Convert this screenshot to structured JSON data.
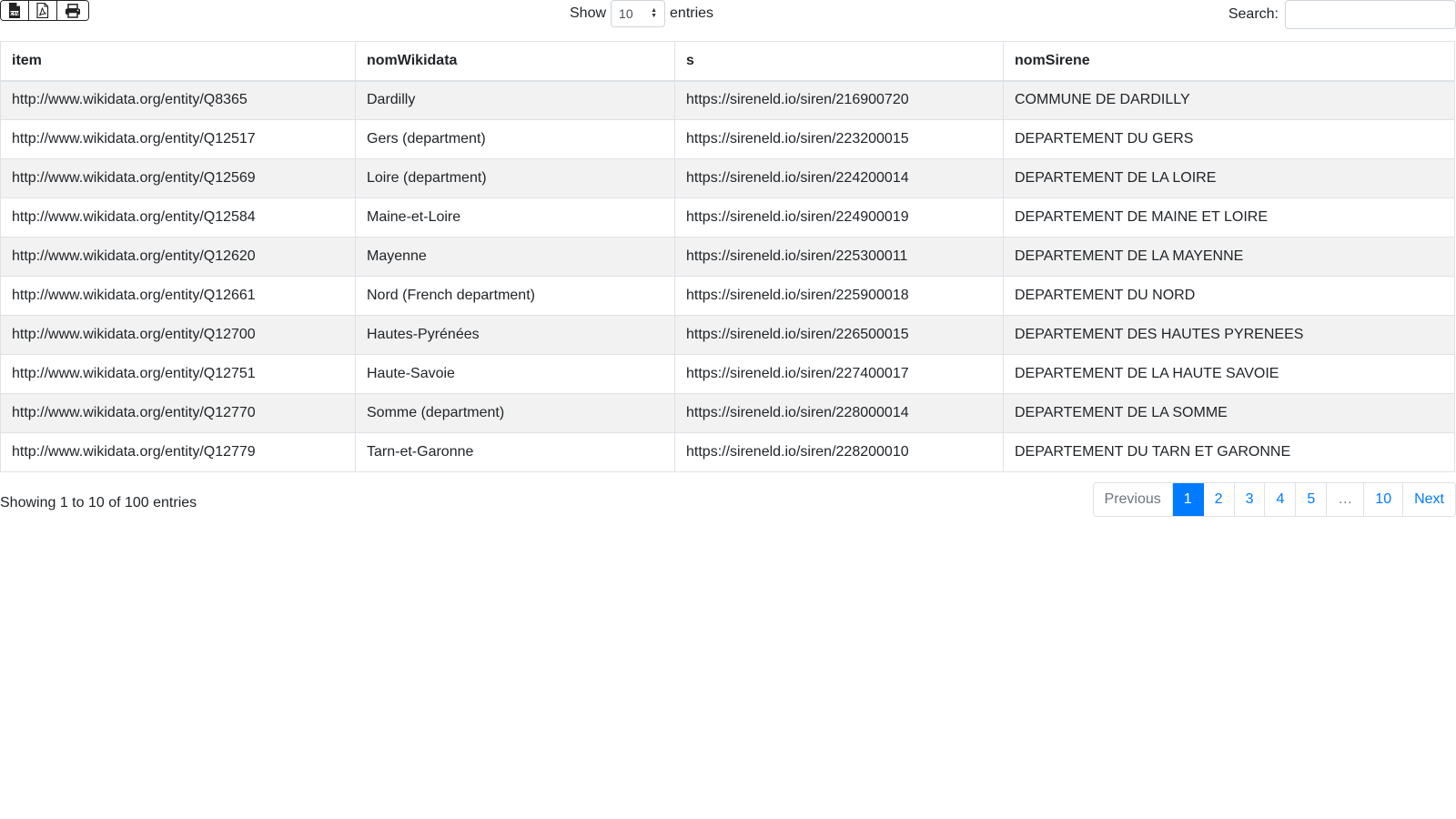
{
  "toolbar": {
    "buttons": [
      {
        "icon": "csv-file-icon"
      },
      {
        "icon": "pdf-file-icon"
      },
      {
        "icon": "print-icon"
      }
    ]
  },
  "length": {
    "show_label": "Show",
    "selected": "10",
    "entries_label": "entries"
  },
  "search": {
    "label": "Search:",
    "value": "",
    "placeholder": ""
  },
  "table": {
    "headers": [
      "item",
      "nomWikidata",
      "s",
      "nomSirene"
    ],
    "rows": [
      [
        "http://www.wikidata.org/entity/Q8365",
        "Dardilly",
        "https://sireneld.io/siren/216900720",
        "COMMUNE DE DARDILLY"
      ],
      [
        "http://www.wikidata.org/entity/Q12517",
        "Gers (department)",
        "https://sireneld.io/siren/223200015",
        "DEPARTEMENT DU GERS"
      ],
      [
        "http://www.wikidata.org/entity/Q12569",
        "Loire (department)",
        "https://sireneld.io/siren/224200014",
        "DEPARTEMENT DE LA LOIRE"
      ],
      [
        "http://www.wikidata.org/entity/Q12584",
        "Maine-et-Loire",
        "https://sireneld.io/siren/224900019",
        "DEPARTEMENT DE MAINE ET LOIRE"
      ],
      [
        "http://www.wikidata.org/entity/Q12620",
        "Mayenne",
        "https://sireneld.io/siren/225300011",
        "DEPARTEMENT DE LA MAYENNE"
      ],
      [
        "http://www.wikidata.org/entity/Q12661",
        "Nord (French department)",
        "https://sireneld.io/siren/225900018",
        "DEPARTEMENT DU NORD"
      ],
      [
        "http://www.wikidata.org/entity/Q12700",
        "Hautes-Pyrénées",
        "https://sireneld.io/siren/226500015",
        "DEPARTEMENT DES HAUTES PYRENEES"
      ],
      [
        "http://www.wikidata.org/entity/Q12751",
        "Haute-Savoie",
        "https://sireneld.io/siren/227400017",
        "DEPARTEMENT DE LA HAUTE SAVOIE"
      ],
      [
        "http://www.wikidata.org/entity/Q12770",
        "Somme (department)",
        "https://sireneld.io/siren/228000014",
        "DEPARTEMENT DE LA SOMME"
      ],
      [
        "http://www.wikidata.org/entity/Q12779",
        "Tarn-et-Garonne",
        "https://sireneld.io/siren/228200010",
        "DEPARTEMENT DU TARN ET GARONNE"
      ]
    ]
  },
  "footer": {
    "info": "Showing 1 to 10 of 100 entries"
  },
  "pagination": {
    "previous": "Previous",
    "pages": [
      "1",
      "2",
      "3",
      "4",
      "5",
      "…",
      "10"
    ],
    "active": "1",
    "next": "Next"
  },
  "colors": {
    "accent": "#007bff",
    "stripe": "#f2f2f2",
    "border": "#dee2e6"
  }
}
